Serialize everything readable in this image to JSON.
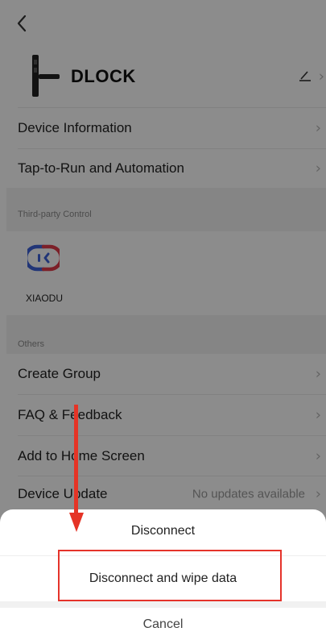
{
  "header": {
    "back_label": "<"
  },
  "device": {
    "name": "DLOCK",
    "edit_icon": "pencil-icon"
  },
  "menu": {
    "device_information": "Device Information",
    "tap_to_run": "Tap-to-Run and Automation"
  },
  "third_party": {
    "section_title": "Third-party Control",
    "xiaodu_label": "XIAODU"
  },
  "others": {
    "section_title": "Others",
    "create_group": "Create Group",
    "faq_feedback": "FAQ & Feedback",
    "add_home": "Add to Home Screen",
    "device_update": "Device Update",
    "update_status": "No updates available"
  },
  "sheet": {
    "disconnect": "Disconnect",
    "disconnect_wipe": "Disconnect and wipe data",
    "cancel": "Cancel"
  },
  "colors": {
    "highlight": "#e5332a",
    "xiaodu_blue": "#3c61d9",
    "xiaodu_red": "#e23b4a"
  }
}
